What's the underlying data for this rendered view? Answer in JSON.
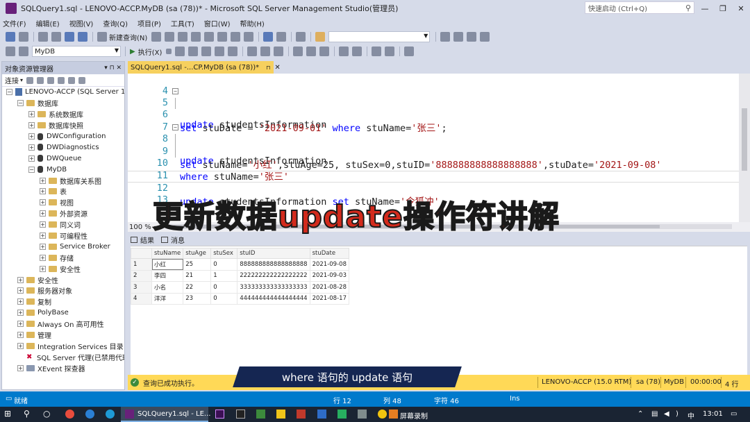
{
  "window": {
    "title": "SQLQuery1.sql - LENOVO-ACCP.MyDB (sa (78))* - Microsoft SQL Server Management Studio(管理员)",
    "quick_launch_placeholder": "快速启动 (Ctrl+Q)"
  },
  "menu": [
    "文件(F)",
    "编辑(E)",
    "视图(V)",
    "查询(Q)",
    "项目(P)",
    "工具(T)",
    "窗口(W)",
    "帮助(H)"
  ],
  "toolbar": {
    "new_query": "新建查询(N)",
    "execute": "执行(X)",
    "database": "MyDB"
  },
  "object_explorer": {
    "title": "对象资源管理器",
    "connect": "连接",
    "server": "LENOVO-ACCP (SQL Server 15",
    "databases": "数据库",
    "system_databases": "系统数据库",
    "database_snapshots": "数据库快照",
    "dw_configuration": "DWConfiguration",
    "dw_diagnostics": "DWDiagnostics",
    "dw_queue": "DWQueue",
    "mydb": "MyDB",
    "mydb_children": [
      "数据库关系图",
      "表",
      "视图",
      "外部资源",
      "同义词",
      "可编程性",
      "Service Broker",
      "存储",
      "安全性"
    ],
    "top_items": [
      "安全性",
      "服务器对象",
      "复制",
      "PolyBase",
      "Always On 高可用性",
      "管理",
      "Integration Services 目录"
    ],
    "sql_agent": "SQL Server 代理(已禁用代理",
    "xevent": "XEvent 探查器"
  },
  "editor": {
    "tab_label": "SQLQuery1.sql -...CP.MyDB (sa (78))*",
    "zoom": "100 %",
    "lines": {
      "l4": "4",
      "l5": "5",
      "l5_kw": "update",
      "l5_id": " studentsInformation",
      "l6": "6",
      "l6_kw1": "set",
      "l6_a": " stuDate = ",
      "l6_s1": "'2021-09-01'",
      "l6_kw2": " where",
      "l6_b": " stuName=",
      "l6_s2": "'张三'",
      "l6_end": ";",
      "l7": "7",
      "l8": "8",
      "l8_kw": "update",
      "l8_id": " studentsInformation",
      "l9": "9",
      "l9_kw": "set",
      "l9_a": " stuName=",
      "l9_s1": "'小红'",
      "l9_b": ",stuAge=25, stuSex=0,stuID=",
      "l9_s2": "'888888888888888888'",
      "l9_c": ",stuDate=",
      "l9_s3": "'2021-09-08'",
      "l10": "10",
      "l10_kw": "where",
      "l10_a": " stuName=",
      "l10_s": "'张三'",
      "l11": "11",
      "l12": "12",
      "l12_kw1": "update",
      "l12_a": " studentsInformation ",
      "l12_kw2": "set",
      "l12_b": " stuName=",
      "l12_s": "'令狐冲'",
      "l13": "13"
    }
  },
  "overlay_title": "更新数据update操作符讲解",
  "results": {
    "tab_results": "结果",
    "tab_messages": "消息",
    "columns": [
      "stuName",
      "stuAge",
      "stuSex",
      "stuID",
      "stuDate"
    ],
    "rows": [
      [
        "1",
        "小红",
        "25",
        "0",
        "888888888888888888",
        "2021-09-08"
      ],
      [
        "2",
        "李四",
        "21",
        "1",
        "222222222222222222",
        "2021-09-03"
      ],
      [
        "3",
        "小名",
        "22",
        "0",
        "333333333333333333",
        "2021-08-28"
      ],
      [
        "4",
        "洋洋",
        "23",
        "0",
        "444444444444444444",
        "2021-08-17"
      ]
    ]
  },
  "query_status": {
    "message": "查询已成功执行。",
    "server": "LENOVO-ACCP (15.0 RTM)",
    "user": "sa (78)",
    "db": "MyDB",
    "time": "00:00:00",
    "rows": "4 行"
  },
  "subtitle": "where 语句的 update 语句",
  "status_bar": {
    "ready": "就绪",
    "line": "行 12",
    "col": "列 48",
    "char": "字符 46",
    "mode": "Ins"
  },
  "taskbar": {
    "active_window": "SQLQuery1.sql - LE...",
    "recorder": "屏幕录制",
    "ime": "中",
    "clock": "13:01"
  }
}
